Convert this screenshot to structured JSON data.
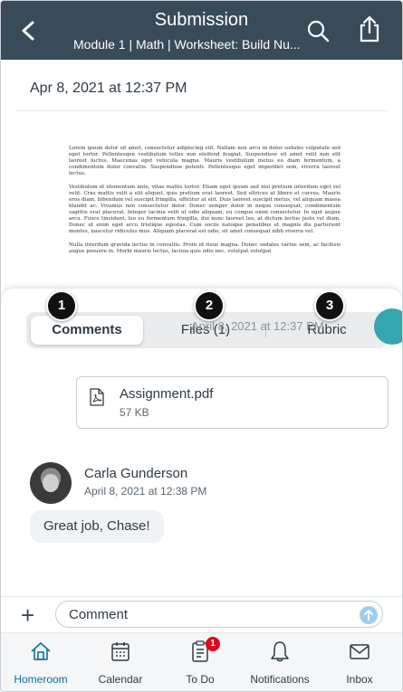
{
  "header": {
    "title": "Submission",
    "subtitle": "Module 1 | Math | Worksheet: Build Nu..."
  },
  "submission_date": "Apr 8, 2021 at 12:37 PM",
  "document": {
    "paragraphs": [
      "Lorem ipsum dolor sit amet, consectetur adipiscing elit. Nullam non arcu in dolor sodales vulputate sed eget tortor. Pellentesque vestibulum tellus non eleifend feugiat. Suspendisse sit amet velit non elit laoreet luctus. Maecenas eget vehicula magna. Mauris vestibulum metus eu diam fermentum, a condimentum dolor convallis. Suspendisse potenti. Pellentesque eget imperdiet sem, viverra laoreet lectus.",
      "Vestibulum et elementum ante, vitae mattis tortor. Etiam eget ipsum sed nisi pretium interdum eget vel velit. Cras mattis velit a elit aliquet, quis pretium erat laoreet. Sed ultrices at libero et cursus. Mauris eros diam, bibendum vel suscipit fringilla, efficitur at elit. Duis laoreet suscipit metus, vel aliquam massa blandit ac. Vivamus non consectetur dolor. Donec semper dolor in neque consequat, condimentum sagittis erat placerat. Integer lacinia velit ut odio aliquam, eu congue enim consectetur. In eget augue arcu. Fusce tincidunt, leo eu fermentum fringilla, dui nunc laoreet leo, at dictum lectus justo vel diam. Donec ut enim eget arcu tristique egestas. Cum sociis natoque penatibus et magnis dis parturient montes, nascetur ridiculus mus. Aliquam placerat est odio, sit amet consequat nibh viverra vel.",
      "Nulla interdum gravida lectus in convallis. Proin id risus magna. Donec sodales varius sem, ac facilisis augue posuere in. Morbi mauris lectus, lacinia quis odio nec, volutpat volutpat"
    ]
  },
  "tabs": [
    {
      "label": "Comments",
      "active": true
    },
    {
      "label": "Files (1)",
      "active": false
    },
    {
      "label": "Rubric",
      "active": false
    }
  ],
  "markers": [
    "1",
    "2",
    "3"
  ],
  "previous_message_date": "April 8, 2021 at 12:37 PM",
  "attachment": {
    "name": "Assignment.pdf",
    "size": "57 KB"
  },
  "comment": {
    "author": "Carla Gunderson",
    "date": "April 8, 2021 at 12:38 PM",
    "text": "Great job, Chase!"
  },
  "composer": {
    "placeholder": "Comment"
  },
  "nav": {
    "items": [
      {
        "label": "Homeroom",
        "icon": "home-icon",
        "active": true
      },
      {
        "label": "Calendar",
        "icon": "calendar-icon",
        "active": false
      },
      {
        "label": "To Do",
        "icon": "todo-icon",
        "active": false,
        "badge": "1"
      },
      {
        "label": "Notifications",
        "icon": "bell-icon",
        "active": false
      },
      {
        "label": "Inbox",
        "icon": "inbox-icon",
        "active": false
      }
    ]
  },
  "colors": {
    "header_bg": "#394b58",
    "active_nav": "#0770a3",
    "badge": "#e0061f",
    "teal": "#35a6ad"
  }
}
